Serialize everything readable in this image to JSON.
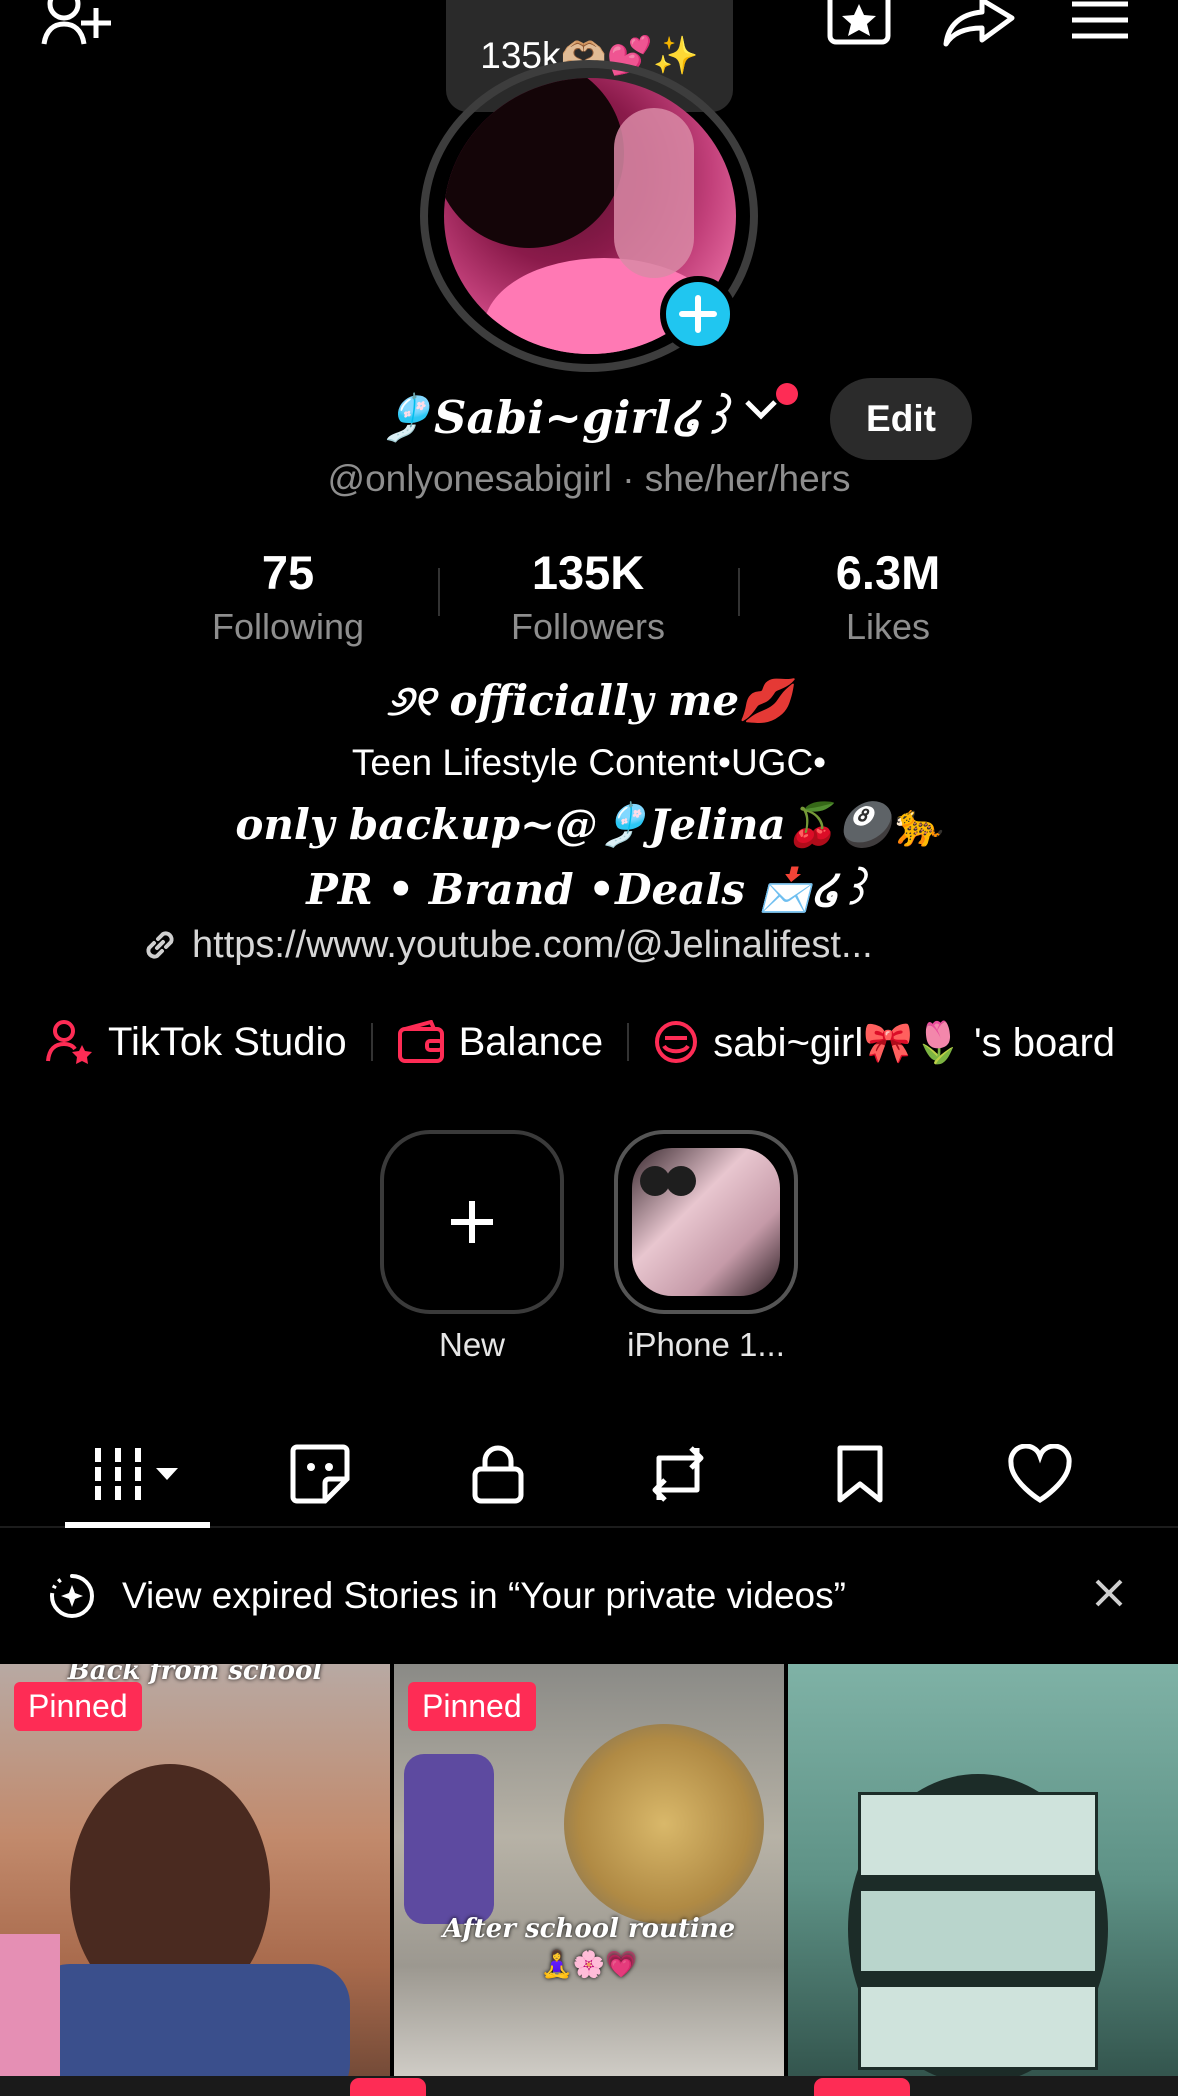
{
  "header": {
    "add_friend_icon": "person-plus-icon",
    "favorites_icon": "star-icon",
    "share_icon": "share-arrow-icon",
    "menu_icon": "hamburger-menu-icon",
    "followers_bubble": "135k🫶🏼💕✨"
  },
  "profile": {
    "display_name": "🎐Sabi~girl໒꒱",
    "edit_label": "Edit",
    "handle_line": "@onlyonesabigirl · she/her/hers"
  },
  "stats": [
    {
      "number": "75",
      "label": "Following"
    },
    {
      "number": "135K",
      "label": "Followers"
    },
    {
      "number": "6.3M",
      "label": "Likes"
    }
  ],
  "bio": {
    "line1": "୬୧ officially me💋",
    "line2": "Teen Lifestyle Content•UGC•",
    "line3": "only backup~@🎐Jelina🍒🎱🐆",
    "line4": "PR • Brand •Deals 📩໒꒱",
    "link": "https://www.youtube.com/@Jelinalifest..."
  },
  "tools": [
    {
      "label": "TikTok Studio",
      "icon": "person-star-icon"
    },
    {
      "label": "Balance",
      "icon": "wallet-icon"
    },
    {
      "label": "sabi~girl🎀🌷 's board",
      "icon": "board-icon"
    }
  ],
  "stories": [
    {
      "label": "New"
    },
    {
      "label": "iPhone 1..."
    }
  ],
  "tabs": [
    "videos-grid-icon",
    "stickers-icon",
    "lock-icon",
    "repost-icon",
    "bookmark-icon",
    "heart-icon"
  ],
  "banner": {
    "text": "View expired Stories in “Your private videos”"
  },
  "videos": [
    {
      "badge": "Pinned",
      "caption_top": "Back from school"
    },
    {
      "badge": "Pinned",
      "caption": "After school routine",
      "caption_emoji": "🧘‍♀️🌸💗"
    },
    {
      "badge": ""
    }
  ],
  "colors": {
    "accent_red": "#fe2c55",
    "accent_blue": "#20c6f0",
    "background": "#000000",
    "secondary_text": "#8e8e8e"
  }
}
